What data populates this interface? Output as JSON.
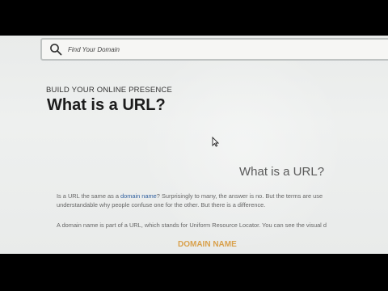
{
  "search": {
    "placeholder": "Find Your Domain"
  },
  "hero": {
    "eyebrow": "BUILD YOUR ONLINE PRESENCE",
    "title": "What is a URL?"
  },
  "article": {
    "title": "What is a URL?",
    "p1_before": "Is a URL the same as a ",
    "p1_link": "domain name",
    "p1_after": "? Surprisingly to many, the answer is no. But the terms are use",
    "p2": "understandable why people confuse one for the other. But there is a difference.",
    "p3": "A domain name is part of a URL, which stands for Uniform Resource Locator. You can see the visual d",
    "diagram_label": "DOMAIN NAME"
  },
  "colors": {
    "link": "#2f5f9e",
    "accent": "#d9a14c"
  }
}
